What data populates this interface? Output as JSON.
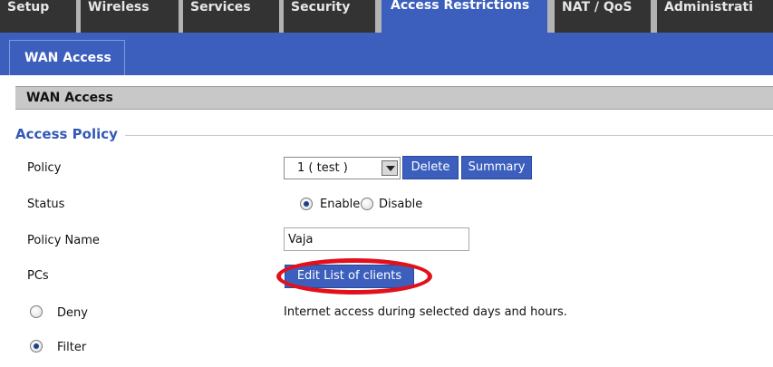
{
  "top_tabs": [
    {
      "label": "Setup"
    },
    {
      "label": "Wireless"
    },
    {
      "label": "Services"
    },
    {
      "label": "Security"
    },
    {
      "label": "Access Restrictions"
    },
    {
      "label": "NAT / QoS"
    },
    {
      "label": "Administrati"
    }
  ],
  "sub_tab": "WAN Access",
  "section_title": "WAN Access",
  "legend": "Access Policy",
  "policy": {
    "label": "Policy",
    "selected": "1 ( test )",
    "delete_label": "Delete",
    "summary_label": "Summary"
  },
  "status": {
    "label": "Status",
    "enable_label": "Enable",
    "disable_label": "Disable",
    "selected": "Enable"
  },
  "policy_name": {
    "label": "Policy Name",
    "value": "Vaja"
  },
  "pcs": {
    "label": "PCs",
    "edit_label": "Edit List of clients"
  },
  "deny": {
    "label": "Deny",
    "description": "Internet access during selected days and hours."
  },
  "filter": {
    "label": "Filter",
    "selected": true
  },
  "colors": {
    "accent": "#3c5fbd",
    "tab_dark": "#333333",
    "highlight": "#e2101a"
  }
}
